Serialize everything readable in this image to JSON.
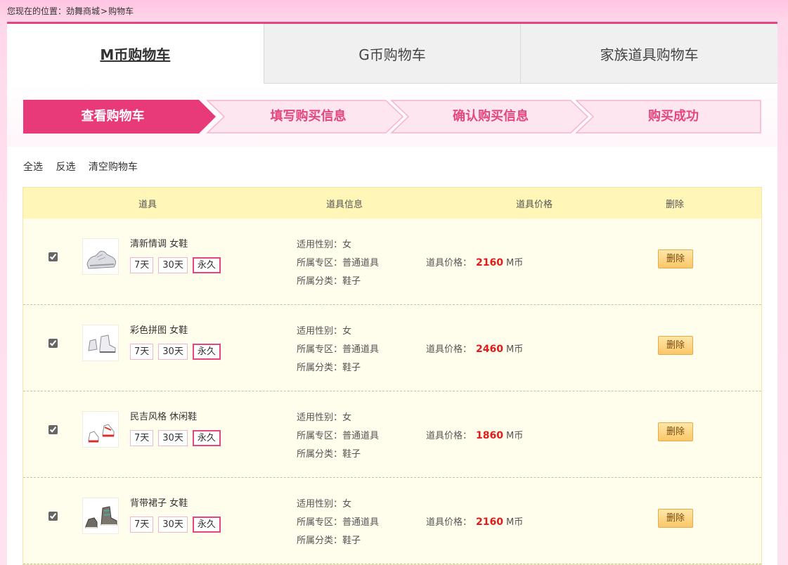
{
  "breadcrumb": {
    "prefix": "您现在的位置：",
    "items": [
      "劲舞商城",
      "购物车"
    ],
    "sep": ">"
  },
  "tabs": [
    {
      "label": "M币购物车",
      "active": true
    },
    {
      "label": "G币购物车",
      "active": false
    },
    {
      "label": "家族道具购物车",
      "active": false
    }
  ],
  "steps": [
    {
      "label": "查看购物车",
      "active": true
    },
    {
      "label": "填写购买信息",
      "active": false
    },
    {
      "label": "确认购买信息",
      "active": false
    },
    {
      "label": "购买成功",
      "active": false
    }
  ],
  "actions": {
    "select_all": "全选",
    "invert": "反选",
    "clear": "清空购物车"
  },
  "table": {
    "headers": {
      "item": "道具",
      "info": "道具信息",
      "price": "道具价格",
      "delete": "删除"
    },
    "rows": [
      {
        "checked": true,
        "name": "清新情调 女鞋",
        "icon": "white-sneaker-icon",
        "durations": [
          "7天",
          "30天",
          "永久"
        ],
        "selected_duration": "永久",
        "gender": "适用性别：女",
        "zone": "所属专区：普通道具",
        "category": "所属分类：鞋子",
        "price_label": "道具价格：",
        "price": "2160",
        "currency": "M币",
        "delete_label": "删除"
      },
      {
        "checked": true,
        "name": "彩色拼图 女鞋",
        "icon": "white-boot-icon",
        "durations": [
          "7天",
          "30天",
          "永久"
        ],
        "selected_duration": "永久",
        "gender": "适用性别：女",
        "zone": "所属专区：普通道具",
        "category": "所属分类：鞋子",
        "price_label": "道具价格：",
        "price": "2460",
        "currency": "M币",
        "delete_label": "删除"
      },
      {
        "checked": true,
        "name": "民吉风格 休闲鞋",
        "icon": "red-shoe-icon",
        "durations": [
          "7天",
          "30天",
          "永久"
        ],
        "selected_duration": "永久",
        "gender": "适用性别：女",
        "zone": "所属专区：普通道具",
        "category": "所属分类：鞋子",
        "price_label": "道具价格：",
        "price": "1860",
        "currency": "M币",
        "delete_label": "删除"
      },
      {
        "checked": true,
        "name": "背带裙子 女鞋",
        "icon": "gray-sneaker-icon",
        "durations": [
          "7天",
          "30天",
          "永久"
        ],
        "selected_duration": "永久",
        "gender": "适用性别：女",
        "zone": "所属专区：普通道具",
        "category": "所属分类：鞋子",
        "price_label": "道具价格：",
        "price": "2160",
        "currency": "M币",
        "delete_label": "删除"
      }
    ]
  },
  "colors": {
    "accent": "#e6467f",
    "header_bg": "#fff6b8",
    "price": "#e21a1a",
    "row_bg": "#fffdec"
  }
}
